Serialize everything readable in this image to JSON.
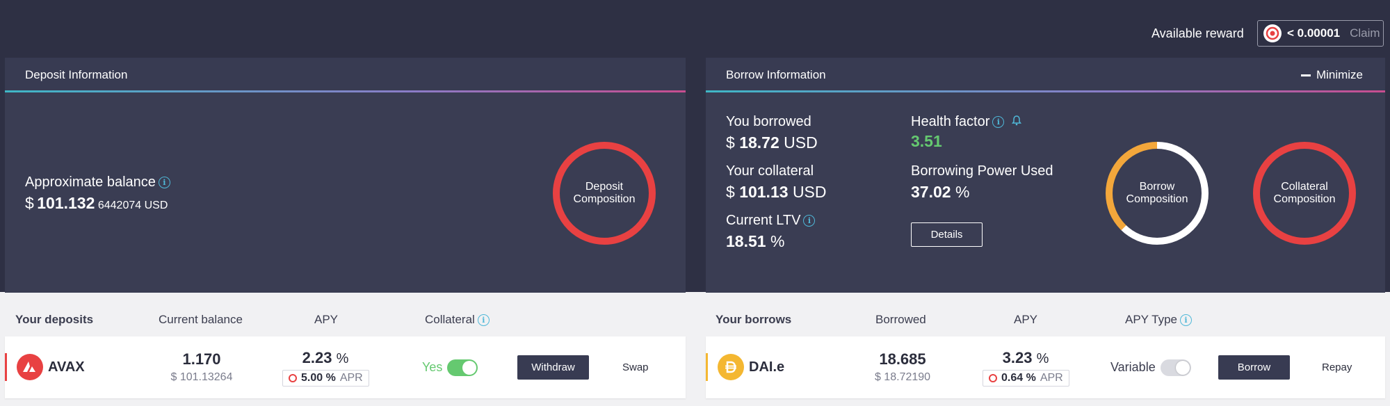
{
  "reward": {
    "label": "Available reward",
    "value": "< 0.00001",
    "claim_label": "Claim"
  },
  "deposit_panel": {
    "title": "Deposit Information",
    "approx_balance_label": "Approximate balance",
    "currency_symbol": "$",
    "balance_main": "101.132",
    "balance_rest": "6442074",
    "balance_unit": "USD",
    "composition_label_line1": "Deposit",
    "composition_label_line2": "Composition"
  },
  "borrow_panel": {
    "title": "Borrow Information",
    "minimize_label": "Minimize",
    "you_borrowed_label": "You borrowed",
    "you_borrowed_value": "18.72",
    "your_collateral_label": "Your collateral",
    "your_collateral_value": "101.13",
    "current_ltv_label": "Current LTV",
    "current_ltv_value": "18.51",
    "health_factor_label": "Health factor",
    "health_factor_value": "3.51",
    "borrowing_power_label": "Borrowing Power Used",
    "borrowing_power_value": "37.02",
    "details_label": "Details",
    "borrow_composition_line1": "Borrow",
    "borrow_composition_line2": "Composition",
    "collateral_composition_line1": "Collateral",
    "collateral_composition_line2": "Composition",
    "currency_symbol": "$",
    "usd_unit": "USD",
    "pct_unit": "%"
  },
  "deposits_table": {
    "headers": [
      "Your deposits",
      "Current balance",
      "APY",
      "Collateral"
    ],
    "row": {
      "asset": "AVAX",
      "balance": "1.170",
      "balance_usd": "$ 101.13264",
      "apy": "2.23",
      "apr": "5.00 %",
      "apr_label": "APR",
      "collateral_label": "Yes",
      "collateral_on": true,
      "withdraw_label": "Withdraw",
      "swap_label": "Swap"
    }
  },
  "borrows_table": {
    "headers": [
      "Your borrows",
      "Borrowed",
      "APY",
      "APY Type"
    ],
    "row": {
      "asset": "DAI.e",
      "borrowed": "18.685",
      "borrowed_usd": "$ 18.72190",
      "apy": "3.23",
      "apr": "0.64 %",
      "apr_label": "APR",
      "apy_type": "Variable",
      "borrow_label": "Borrow",
      "repay_label": "Repay"
    }
  },
  "colors": {
    "avax_red": "#e84142",
    "dai_gold": "#f4b731",
    "health_green": "#65c970",
    "toggle_on": "#65c970",
    "panel_bg": "#383b52",
    "top_bg": "#2e3044"
  }
}
